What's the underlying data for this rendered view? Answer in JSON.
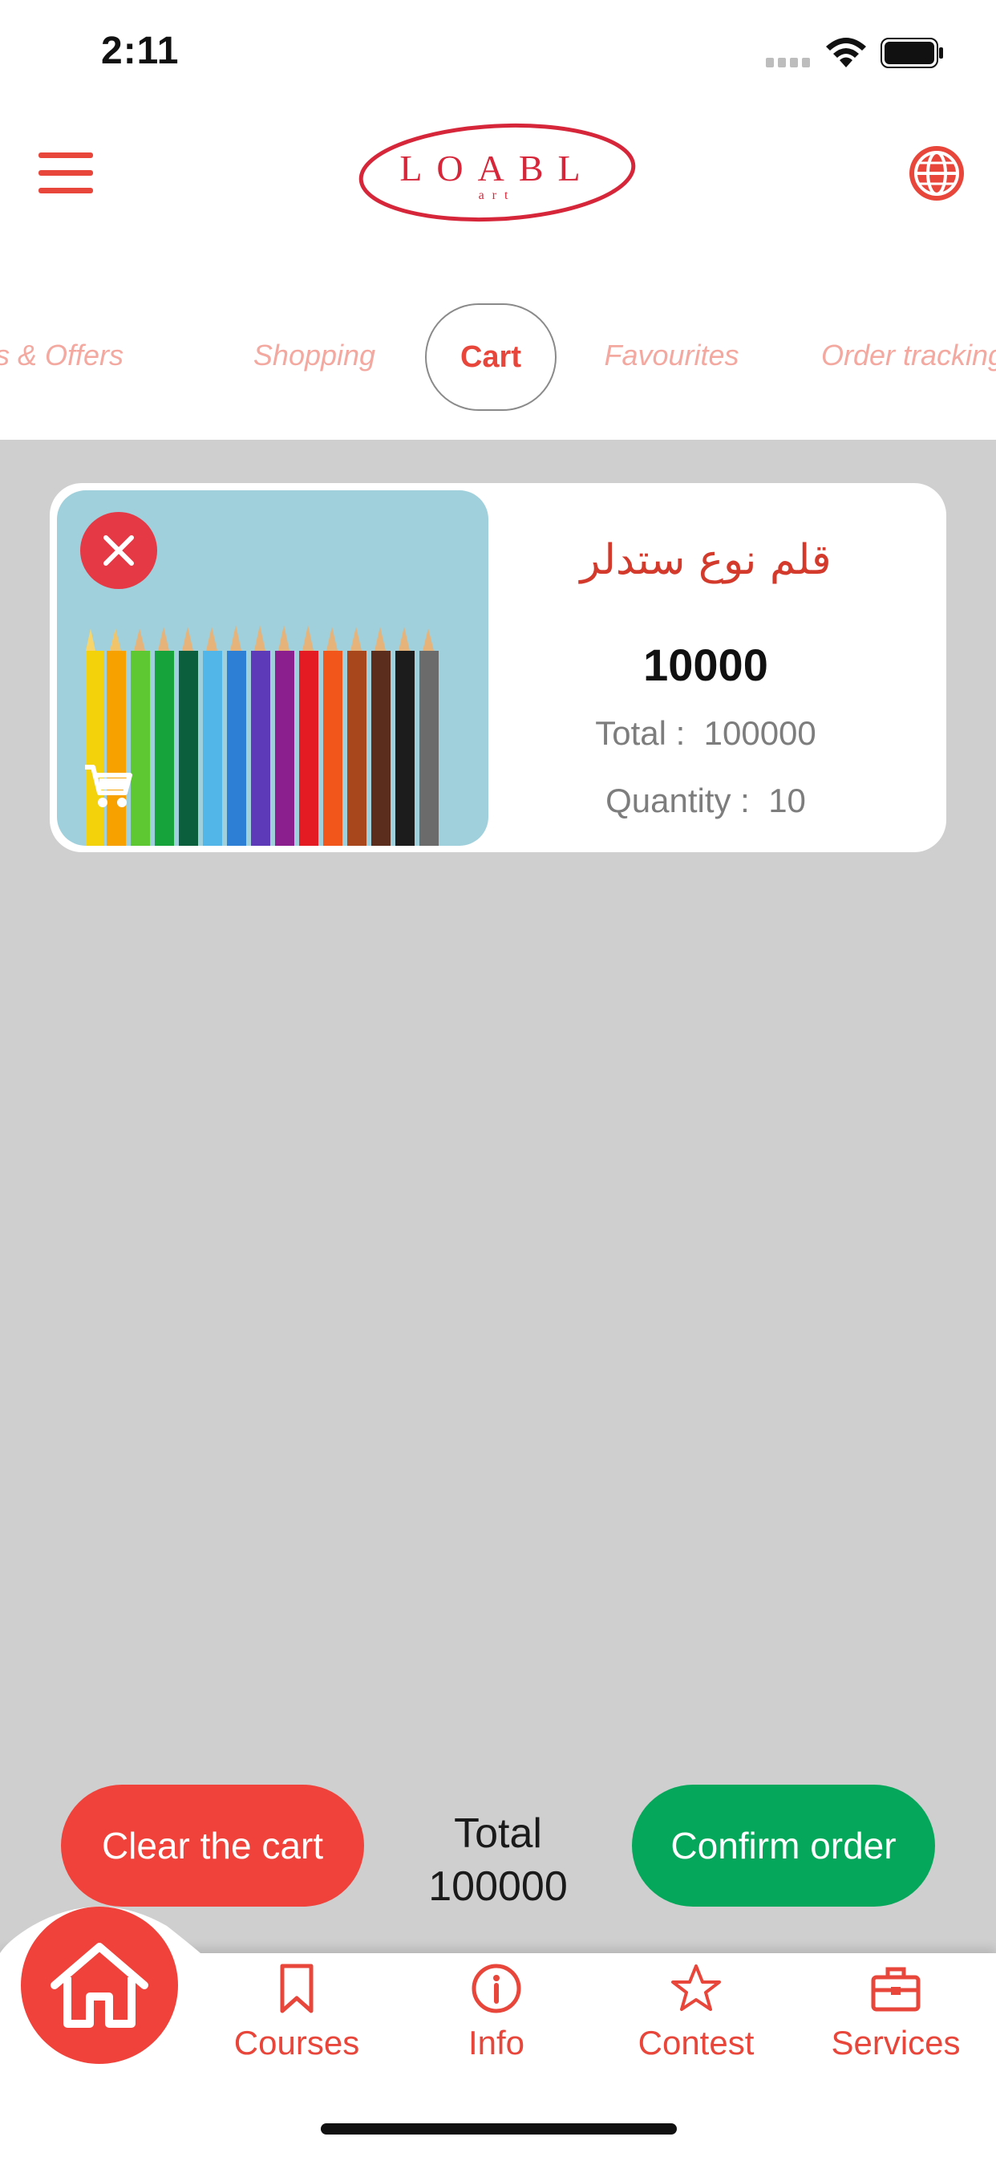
{
  "status_bar": {
    "time": "2:11"
  },
  "header": {
    "menu_icon": "hamburger-icon",
    "logo": {
      "main": "LOABL",
      "sub": "art"
    },
    "language_icon": "globe-icon"
  },
  "tabs": [
    {
      "label": "News & Offers"
    },
    {
      "label": "Shopping"
    },
    {
      "label": "Cart",
      "active": true
    },
    {
      "label": "Favourites"
    },
    {
      "label": "Order tracking"
    }
  ],
  "cart": {
    "items": [
      {
        "name": "قلم نوع ستدلر",
        "price": "10000",
        "total_label": "Total :",
        "total_value": "100000",
        "quantity_label": "Quantity :",
        "quantity_value": "10"
      }
    ]
  },
  "footer": {
    "clear_label": "Clear the cart",
    "total_label": "Total",
    "total_value": "100000",
    "confirm_label": "Confirm order"
  },
  "bottom_nav": {
    "items": [
      {
        "label": "",
        "icon": "home-icon"
      },
      {
        "label": "Courses",
        "icon": "bookmark-icon"
      },
      {
        "label": "Info",
        "icon": "info-icon"
      },
      {
        "label": "Contest",
        "icon": "star-icon"
      },
      {
        "label": "Services",
        "icon": "toolbox-icon"
      }
    ]
  },
  "colors": {
    "accent": "#e8463a",
    "clear_button": "#f0423a",
    "confirm_button": "#05a85a",
    "content_background": "#cfcfcf",
    "remove_button": "#e63946"
  }
}
